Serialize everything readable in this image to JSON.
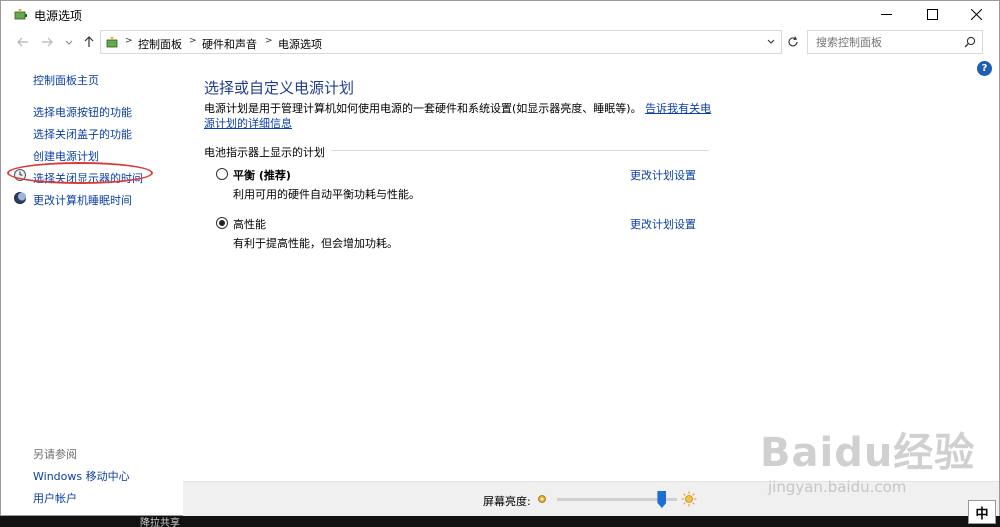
{
  "window": {
    "title": "电源选项"
  },
  "address": {
    "crumbs": [
      "控制面板",
      "硬件和声音",
      "电源选项"
    ]
  },
  "search": {
    "placeholder": "搜索控制面板"
  },
  "help": {
    "label": "?"
  },
  "left": {
    "home": "控制面板主页",
    "links": [
      "选择电源按钮的功能",
      "选择关闭盖子的功能",
      "创建电源计划",
      "选择关闭显示器的时间",
      "更改计算机睡眠时间"
    ],
    "see_also": "另请参阅",
    "also_links": [
      "Windows 移动中心",
      "用户帐户"
    ]
  },
  "main": {
    "title": "选择或自定义电源计划",
    "desc_text": "电源计划是用于管理计算机如何使用电源的一套硬件和系统设置(如显示器亮度、睡眠等)。",
    "desc_link": "告诉我有关电源计划的详细信息",
    "section": "电池指示器上显示的计划",
    "plans": [
      {
        "name": "平衡 (推荐)",
        "desc": "利用可用的硬件自动平衡功耗与性能。",
        "link": "更改计划设置",
        "selected": false
      },
      {
        "name": "高性能",
        "desc": "有利于提高性能，但会增加功耗。",
        "link": "更改计划设置",
        "selected": true
      }
    ]
  },
  "brightness": {
    "label": "屏幕亮度:",
    "level": 0.87
  },
  "taskbar": {
    "partial_text": "降拉共享",
    "ime": "中"
  },
  "watermark": {
    "main": "Baidu经验",
    "sub": "jingyan.baidu.com"
  },
  "colors": {
    "link": "#0b3ea6",
    "title": "#1e3f8f",
    "highlight": "#d83a3a",
    "accent": "#1f6fd0"
  }
}
